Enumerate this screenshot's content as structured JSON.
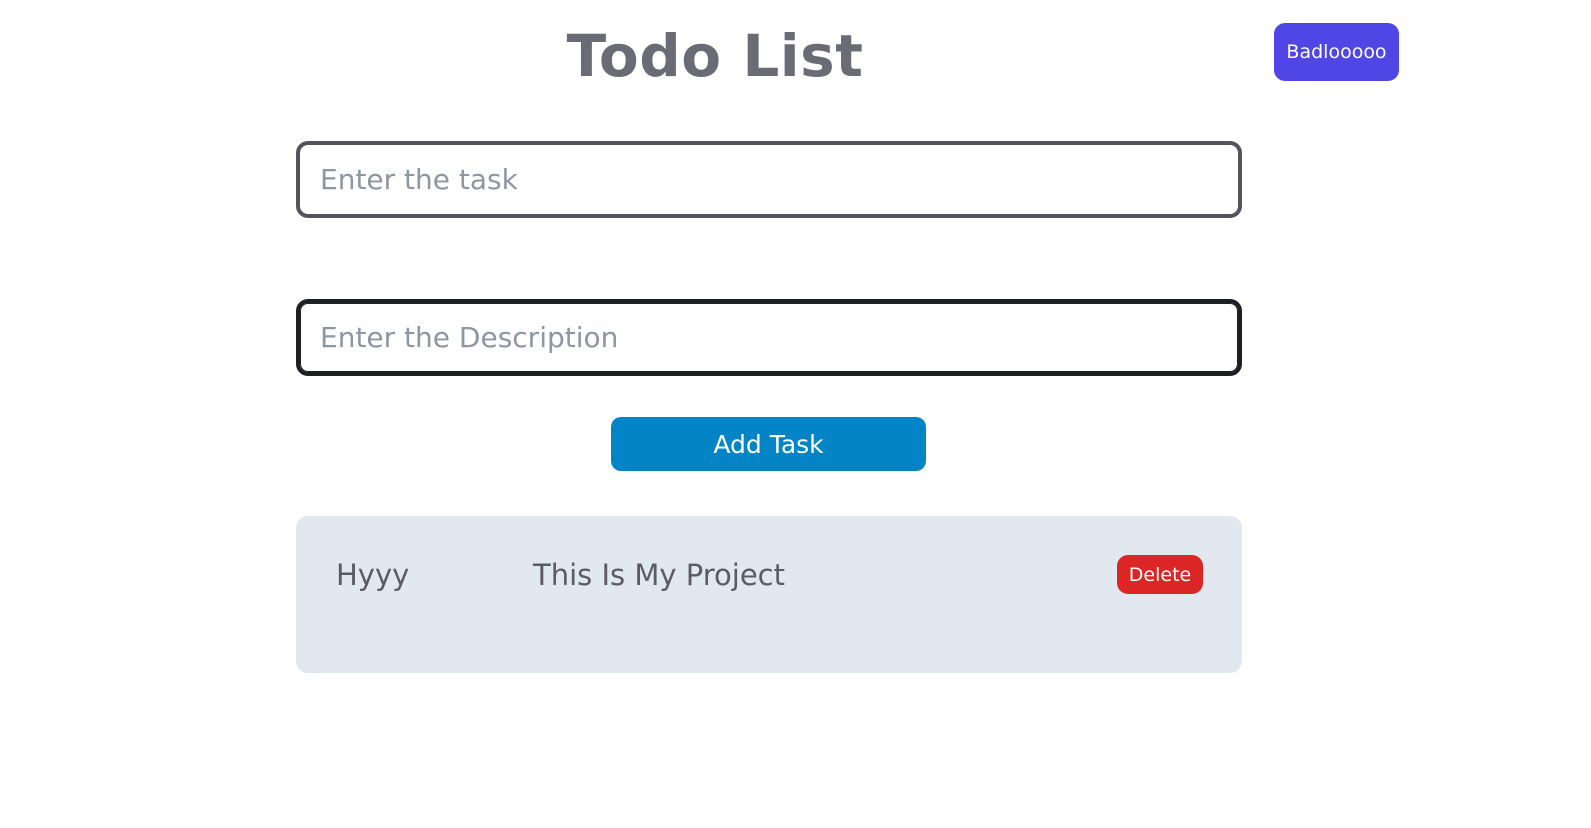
{
  "header": {
    "title": "Todo List",
    "theme_button_label": "Badlooooo"
  },
  "form": {
    "task_input": {
      "value": "",
      "placeholder": "Enter the task"
    },
    "description_input": {
      "value": "",
      "placeholder": "Enter the Description"
    },
    "add_button_label": "Add Task"
  },
  "tasks": [
    {
      "title": "Hyyy",
      "description": "This Is My Project",
      "delete_label": "Delete"
    }
  ],
  "colors": {
    "title": "#6b6b76",
    "theme_button": "#4f46e5",
    "add_button": "#0284c7",
    "delete_button": "#dc2626",
    "card_background": "#e2e8f0"
  }
}
